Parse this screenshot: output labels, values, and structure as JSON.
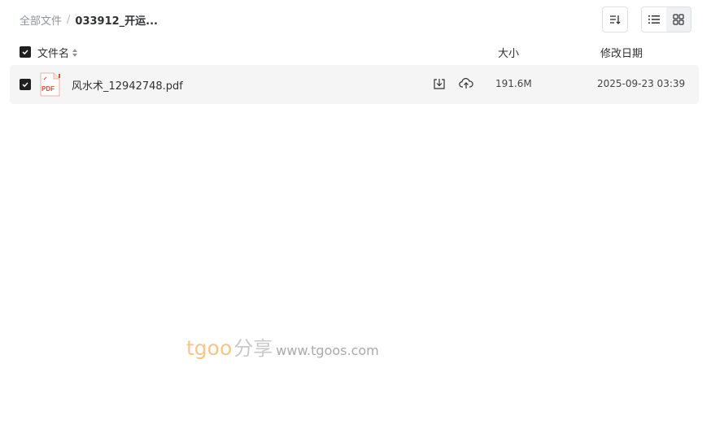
{
  "breadcrumb": {
    "root": "全部文件",
    "separator": "/",
    "current": "033912_开运..."
  },
  "toolbar": {
    "sort_icon": "sort-icon",
    "list_view_icon": "list-view-icon",
    "grid_view_icon": "grid-view-icon",
    "active_view": "list"
  },
  "table": {
    "headers": {
      "name": "文件名",
      "size": "大小",
      "date": "修改日期"
    },
    "rows": [
      {
        "name": "风水术_12942748.pdf",
        "type_icon": "pdf-file-icon",
        "type_label": "PDF",
        "size": "191.6M",
        "modified": "2025-09-23 03:39",
        "checked": true
      }
    ]
  },
  "watermark": {
    "latin": "tgoo",
    "chinese": "分享",
    "url": "www.tgoos.com"
  },
  "colors": {
    "accent_dark": "#1f1f1f",
    "row_bg": "#f5f5f6",
    "pdf_red": "#e04b3a",
    "watermark_orange": "#f3c78c"
  }
}
